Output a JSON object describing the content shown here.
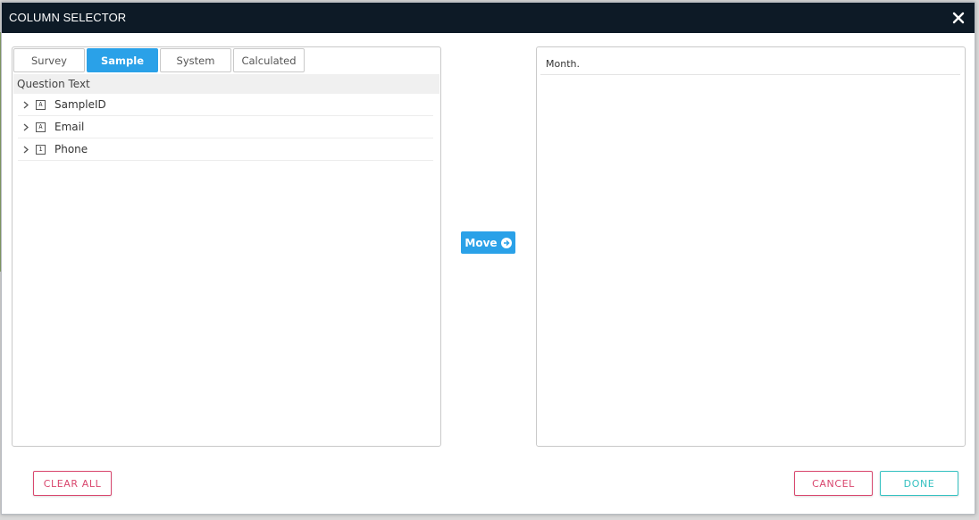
{
  "dialog": {
    "title": "COLUMN SELECTOR"
  },
  "tabs": [
    {
      "label": "Survey",
      "active": false
    },
    {
      "label": "Sample",
      "active": true
    },
    {
      "label": "System",
      "active": false
    },
    {
      "label": "Calculated",
      "active": false
    }
  ],
  "left_panel": {
    "column_header": "Question Text",
    "items": [
      {
        "label": "SampleID",
        "type_icon": "text-type-icon",
        "type_glyph": "A"
      },
      {
        "label": "Email",
        "type_icon": "text-type-icon",
        "type_glyph": "A"
      },
      {
        "label": "Phone",
        "type_icon": "number-type-icon",
        "type_glyph": "1"
      }
    ]
  },
  "move_button": {
    "label": "Move",
    "icon": "arrow-right-circle-icon"
  },
  "right_panel": {
    "items": [
      {
        "label": "Month."
      }
    ]
  },
  "footer": {
    "clear_all_label": "CLEAR ALL",
    "cancel_label": "CANCEL",
    "done_label": "DONE"
  },
  "colors": {
    "titlebar": "#0d1a26",
    "accent_blue": "#2aa1e8",
    "danger": "#d9476e",
    "teal": "#35c1c1"
  }
}
